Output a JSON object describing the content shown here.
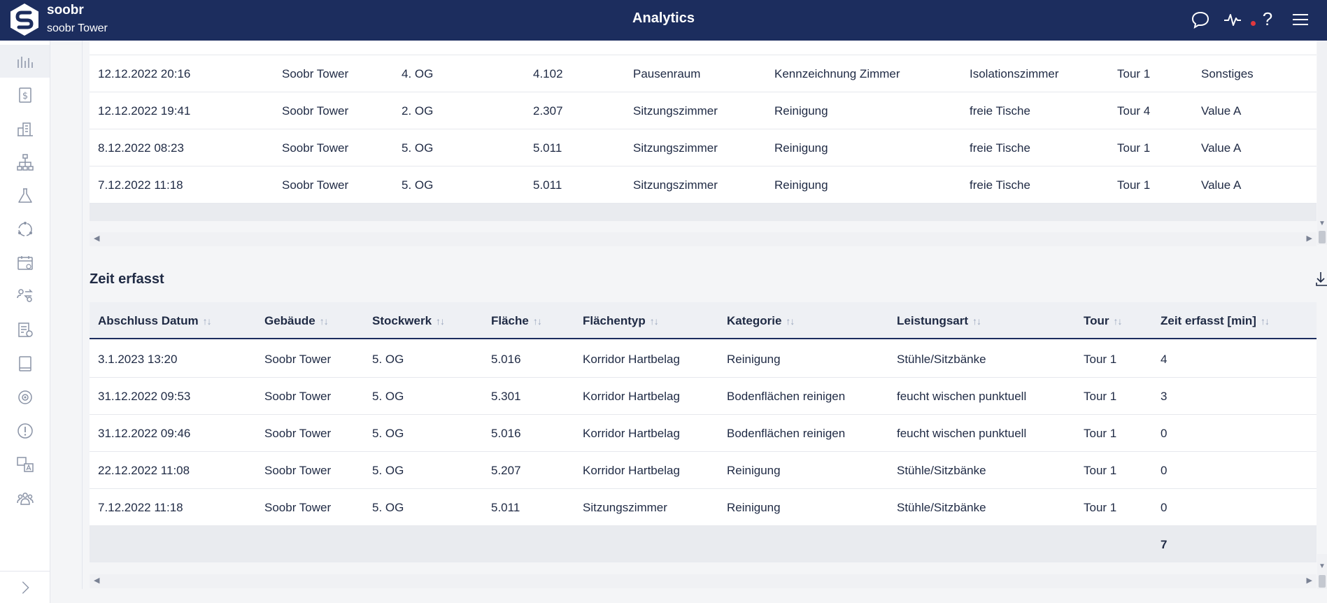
{
  "header": {
    "brand_name": "soobr",
    "brand_sub": "soobr Tower",
    "title": "Analytics",
    "icons": [
      "chat-icon",
      "activity-icon",
      "help-icon",
      "menu-icon"
    ],
    "help_label": "?",
    "accent": "#1c2d5e",
    "notification_color": "#e0383e"
  },
  "sidebar": {
    "items": [
      "analytics-icon",
      "billing-icon",
      "buildings-icon",
      "hierarchy-icon",
      "lab-icon",
      "cycle-icon",
      "calendar-icon",
      "transfer-icon",
      "task-list-icon",
      "book-icon",
      "target-icon",
      "alert-icon",
      "translate-icon",
      "team-icon"
    ],
    "expand_icon": "chevron-right-icon"
  },
  "table1": {
    "rows": [
      [
        "12.12.2022 20:16",
        "Soobr Tower",
        "4. OG",
        "4.102",
        "Pausenraum",
        "Kennzeichnung Zimmer",
        "Isolationszimmer",
        "Tour 1",
        "Sonstiges"
      ],
      [
        "12.12.2022 19:41",
        "Soobr Tower",
        "2. OG",
        "2.307",
        "Sitzungszimmer",
        "Reinigung",
        "freie Tische",
        "Tour 4",
        "Value A"
      ],
      [
        "8.12.2022 08:23",
        "Soobr Tower",
        "5. OG",
        "5.011",
        "Sitzungszimmer",
        "Reinigung",
        "freie Tische",
        "Tour 1",
        "Value A"
      ],
      [
        "7.12.2022 11:18",
        "Soobr Tower",
        "5. OG",
        "5.011",
        "Sitzungszimmer",
        "Reinigung",
        "freie Tische",
        "Tour 1",
        "Value A"
      ]
    ]
  },
  "table2": {
    "title": "Zeit erfasst",
    "sort_glyph": "↑↓",
    "columns": [
      "Abschluss Datum",
      "Gebäude",
      "Stockwerk",
      "Fläche",
      "Flächentyp",
      "Kategorie",
      "Leistungsart",
      "Tour",
      "Zeit erfasst [min]"
    ],
    "rows": [
      [
        "3.1.2023 13:20",
        "Soobr Tower",
        "5. OG",
        "5.016",
        "Korridor Hartbelag",
        "Reinigung",
        "Stühle/Sitzbänke",
        "Tour 1",
        "4"
      ],
      [
        "31.12.2022 09:53",
        "Soobr Tower",
        "5. OG",
        "5.301",
        "Korridor Hartbelag",
        "Bodenflächen reinigen",
        "feucht wischen punktuell",
        "Tour 1",
        "3"
      ],
      [
        "31.12.2022 09:46",
        "Soobr Tower",
        "5. OG",
        "5.016",
        "Korridor Hartbelag",
        "Bodenflächen reinigen",
        "feucht wischen punktuell",
        "Tour 1",
        "0"
      ],
      [
        "22.12.2022 11:08",
        "Soobr Tower",
        "5. OG",
        "5.207",
        "Korridor Hartbelag",
        "Reinigung",
        "Stühle/Sitzbänke",
        "Tour 1",
        "0"
      ],
      [
        "7.12.2022 11:18",
        "Soobr Tower",
        "5. OG",
        "5.011",
        "Sitzungszimmer",
        "Reinigung",
        "Stühle/Sitzbänke",
        "Tour 1",
        "0"
      ]
    ],
    "total": "7",
    "download_icon": "download-icon"
  }
}
